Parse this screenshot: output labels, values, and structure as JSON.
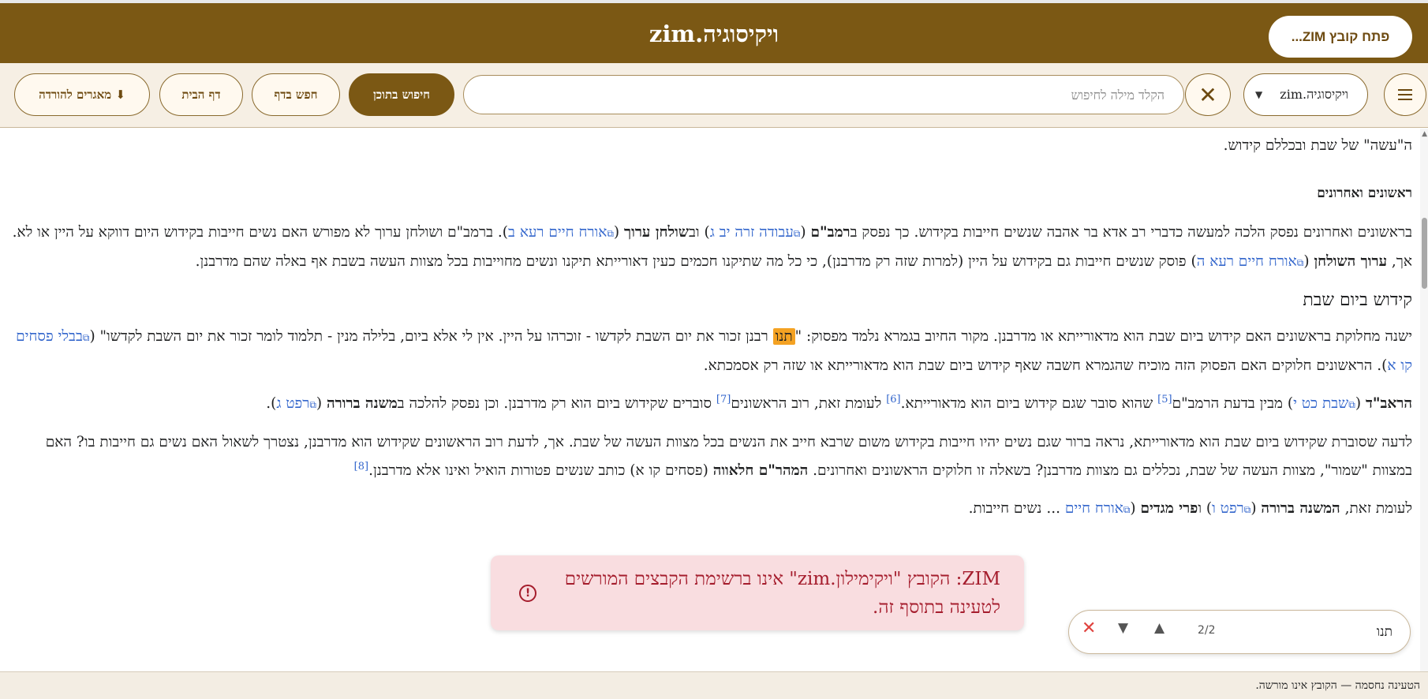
{
  "header": {
    "title": "ויקיסוגיה.zim",
    "open_button": "פתח קובץ ZIM..."
  },
  "toolbar": {
    "book_select": "ויקיסוגיה.zim",
    "search_placeholder": "הקלד מילה לחיפוש",
    "search_content": "חיפוש בתוכן",
    "find_in_page": "חפש בדף",
    "home": "דף הבית",
    "download": "⬇ מאגרים להורדה"
  },
  "article": {
    "p0": "ה\"עשה\" של שבת ובכללם קידוש.",
    "h_rishonim": "ראשונים ואחרונים",
    "p1": {
      "t1": "בראשונים ואחרונים נפסק הלכה למעשה כדברי רב אדא בר אהבה שנשים חייבות בקידוש. כך נפסק ב",
      "b1": "רמב\"ם",
      "t2": " (",
      "l1": "עבודה זרה יב ג",
      "t3": ") וב",
      "b2": "שולחן ערוך",
      "t4": " (",
      "l2": "אורח חיים רעא ב",
      "t5": "). ברמב\"ם ושולחן ערוך לא מפורש האם נשים חייבות בקידוש היום דווקא על היין או לא. אך, ",
      "b3": "ערוך השולחן",
      "t6": " (",
      "l3": "אורח חיים רעא ה",
      "t7": ") פוסק שנשים חייבות גם בקידוש על היין (למרות שזה רק מדרבנן), כי כל מה שתיקנו חכמים כעין דאורייתא תיקנו ונשים מחוייבות בכל מצוות העשה בשבת אף באלה שהם מדרבנן."
    },
    "h_kiddush_day": "קידוש ביום שבת",
    "p2": {
      "t1": "ישנה מחלוקת בראשונים האם קידוש ביום שבת הוא מדאורייתא או מדרבנן. מקור החיוב בגמרא נלמד מפסוק: \"",
      "hl": "תנו",
      "t2": " רבנן זכור את יום השבת לקדשו - זוכרהו על היין. אין לי אלא ביום, בלילה מנין - תלמוד לומר זכור את יום השבת לקדשו\" (",
      "l1": "בבלי פסחים קו א",
      "t3": "). הראשונים חלוקים האם הפסוק הזה מוכיח שהגמרא חשבה שאף קידוש ביום שבת הוא מדאורייתא או שזה רק אסמכתא."
    },
    "p3": {
      "b1": "הראב\"ד",
      "t1": " (",
      "l1": "שבת כט י",
      "t2": ") מבין בדעת הרמב\"ם",
      "s1": "[5]",
      "t3": " שהוא סובר שגם קידוש ביום הוא מדאורייתא.",
      "s2": "[6]",
      "t4": " לעומת זאת, רוב הראשונים",
      "s3": "[7]",
      "t5": " סוברים שקידוש ביום הוא רק מדרבנן. וכן נפסק להלכה ב",
      "b2": "משנה ברורה",
      "t6": " (",
      "l2": "רפט ג",
      "t7": ")."
    },
    "p4": {
      "t1": "לדעה שסוברת שקידוש ביום שבת הוא מדאורייתא, נראה ברור שגם נשים יהיו חייבות בקידוש משום שרבא חייב את הנשים בכל מצוות העשה של שבת. אך, לדעת רוב הראשונים שקידוש הוא מדרבנן, נצטרך לשאול האם נשים גם חייבות בו? האם במצוות \"שמור\", מצוות העשה של שבת, נכללים גם מצוות מדרבנן? בשאלה זו חלוקים הראשונים ואחרונים. ",
      "b1": "המהר\"ם חלאווה",
      "t2": " (פסחים קו א) כותב שנשים פטורות הואיל ואינו אלא מדרבנן.",
      "s1": "[8]"
    },
    "p5": {
      "t1": "לעומת זאת, ",
      "b1": "המשנה ברורה",
      "t2": " (",
      "l1": "רפט ו",
      "t3": ") ו",
      "b2": "פרי מגדים",
      "t4": " (",
      "l2": "אורח חיים",
      "t5": " ... נשים חייבות."
    }
  },
  "toast": {
    "message": "ZIM: הקובץ \"ויקימילון.zim\" אינו ברשימת הקבצים המורשים לטעינה בתוסף זה."
  },
  "findbar": {
    "query": "תנו",
    "count": "2/2"
  },
  "status": {
    "text": "הטעינה נחסמה — הקובץ אינו מורשה."
  },
  "colors": {
    "brand": "#7b5814",
    "toolbar_bg": "#f6efe4",
    "link": "#3366cc",
    "highlight": "#f4a223",
    "error_text": "#a51d2d",
    "error_bg": "#f9dde0"
  },
  "icons": [
    "menu-icon",
    "chevron-down-icon",
    "close-icon",
    "external-link-icon",
    "alert-circle-icon",
    "arrow-up-icon",
    "arrow-down-icon",
    "download-icon"
  ]
}
